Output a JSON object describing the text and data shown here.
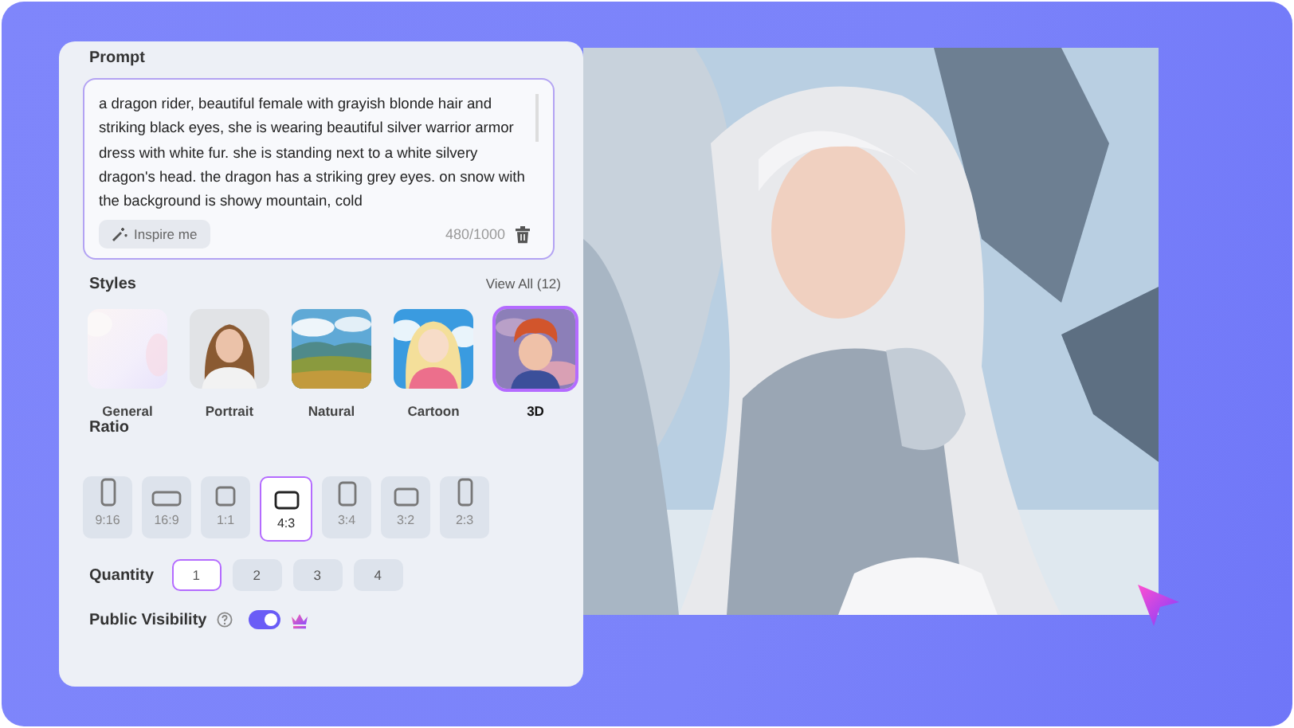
{
  "prompt": {
    "label": "Prompt",
    "value": "a dragon rider, beautiful female with grayish blonde hair and striking black eyes, she is wearing beautiful silver warrior armor dress with white fur. she is standing next to a white silvery dragon's head. the dragon has a striking grey eyes. on snow with the background is showy mountain, cold",
    "inspire_button": "Inspire me",
    "counter": "480/1000"
  },
  "styles": {
    "label": "Styles",
    "view_all": "View All (12)",
    "items": [
      {
        "label": "General",
        "kind": "blank",
        "selected": false
      },
      {
        "label": "Portrait",
        "kind": "portrait",
        "selected": false
      },
      {
        "label": "Natural",
        "kind": "landscape",
        "selected": false
      },
      {
        "label": "Cartoon",
        "kind": "cartoon",
        "selected": false
      },
      {
        "label": "3D",
        "kind": "render",
        "selected": true
      }
    ]
  },
  "ratio": {
    "label": "Ratio",
    "items": [
      {
        "label": "9:16",
        "kind": "tall",
        "selected": false
      },
      {
        "label": "16:9",
        "kind": "wide",
        "selected": false
      },
      {
        "label": "1:1",
        "kind": "square",
        "selected": false
      },
      {
        "label": "4:3",
        "kind": "landscape",
        "selected": true
      },
      {
        "label": "3:4",
        "kind": "portrait",
        "selected": false
      },
      {
        "label": "3:2",
        "kind": "landscape",
        "selected": false
      },
      {
        "label": "2:3",
        "kind": "tall",
        "selected": false
      }
    ]
  },
  "quantity": {
    "label": "Quantity",
    "items": [
      {
        "label": "1",
        "selected": true
      },
      {
        "label": "2",
        "selected": false
      },
      {
        "label": "3",
        "selected": false
      },
      {
        "label": "4",
        "selected": false
      }
    ]
  },
  "public_visibility": {
    "label": "Public Visibility",
    "on": true,
    "premium": true
  }
}
